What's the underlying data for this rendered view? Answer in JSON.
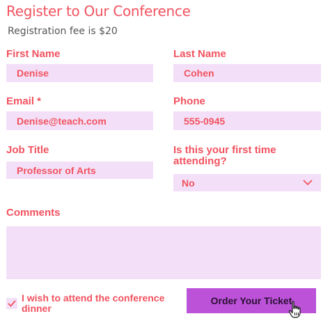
{
  "header": {
    "title": "Register to Our Conference",
    "subtitle": "Registration fee is $20"
  },
  "form": {
    "first_name": {
      "label": "First Name",
      "value": "Denise"
    },
    "last_name": {
      "label": "Last Name",
      "value": "Cohen"
    },
    "email": {
      "label": "Email *",
      "value": "Denise@teach.com"
    },
    "phone": {
      "label": "Phone",
      "value": "555-0945"
    },
    "job_title": {
      "label": "Job Title",
      "value": "Professor of Arts"
    },
    "first_time": {
      "label_line1": "Is this your first time",
      "label_line2": "attending?",
      "value": "No"
    },
    "comments": {
      "label": "Comments",
      "value": ""
    },
    "dinner": {
      "label_line1": "I wish to attend the conference",
      "label_line2": "dinner",
      "checked": true
    },
    "submit_label": "Order Your Ticket"
  },
  "colors": {
    "accent": "#f1525f",
    "field_bg": "#f3e0f8",
    "button_bg": "#bb52d8"
  },
  "icons": {
    "dropdown": "chevron-down-icon",
    "checkbox": "checkmark-icon",
    "cursor": "hand-pointer-icon"
  }
}
